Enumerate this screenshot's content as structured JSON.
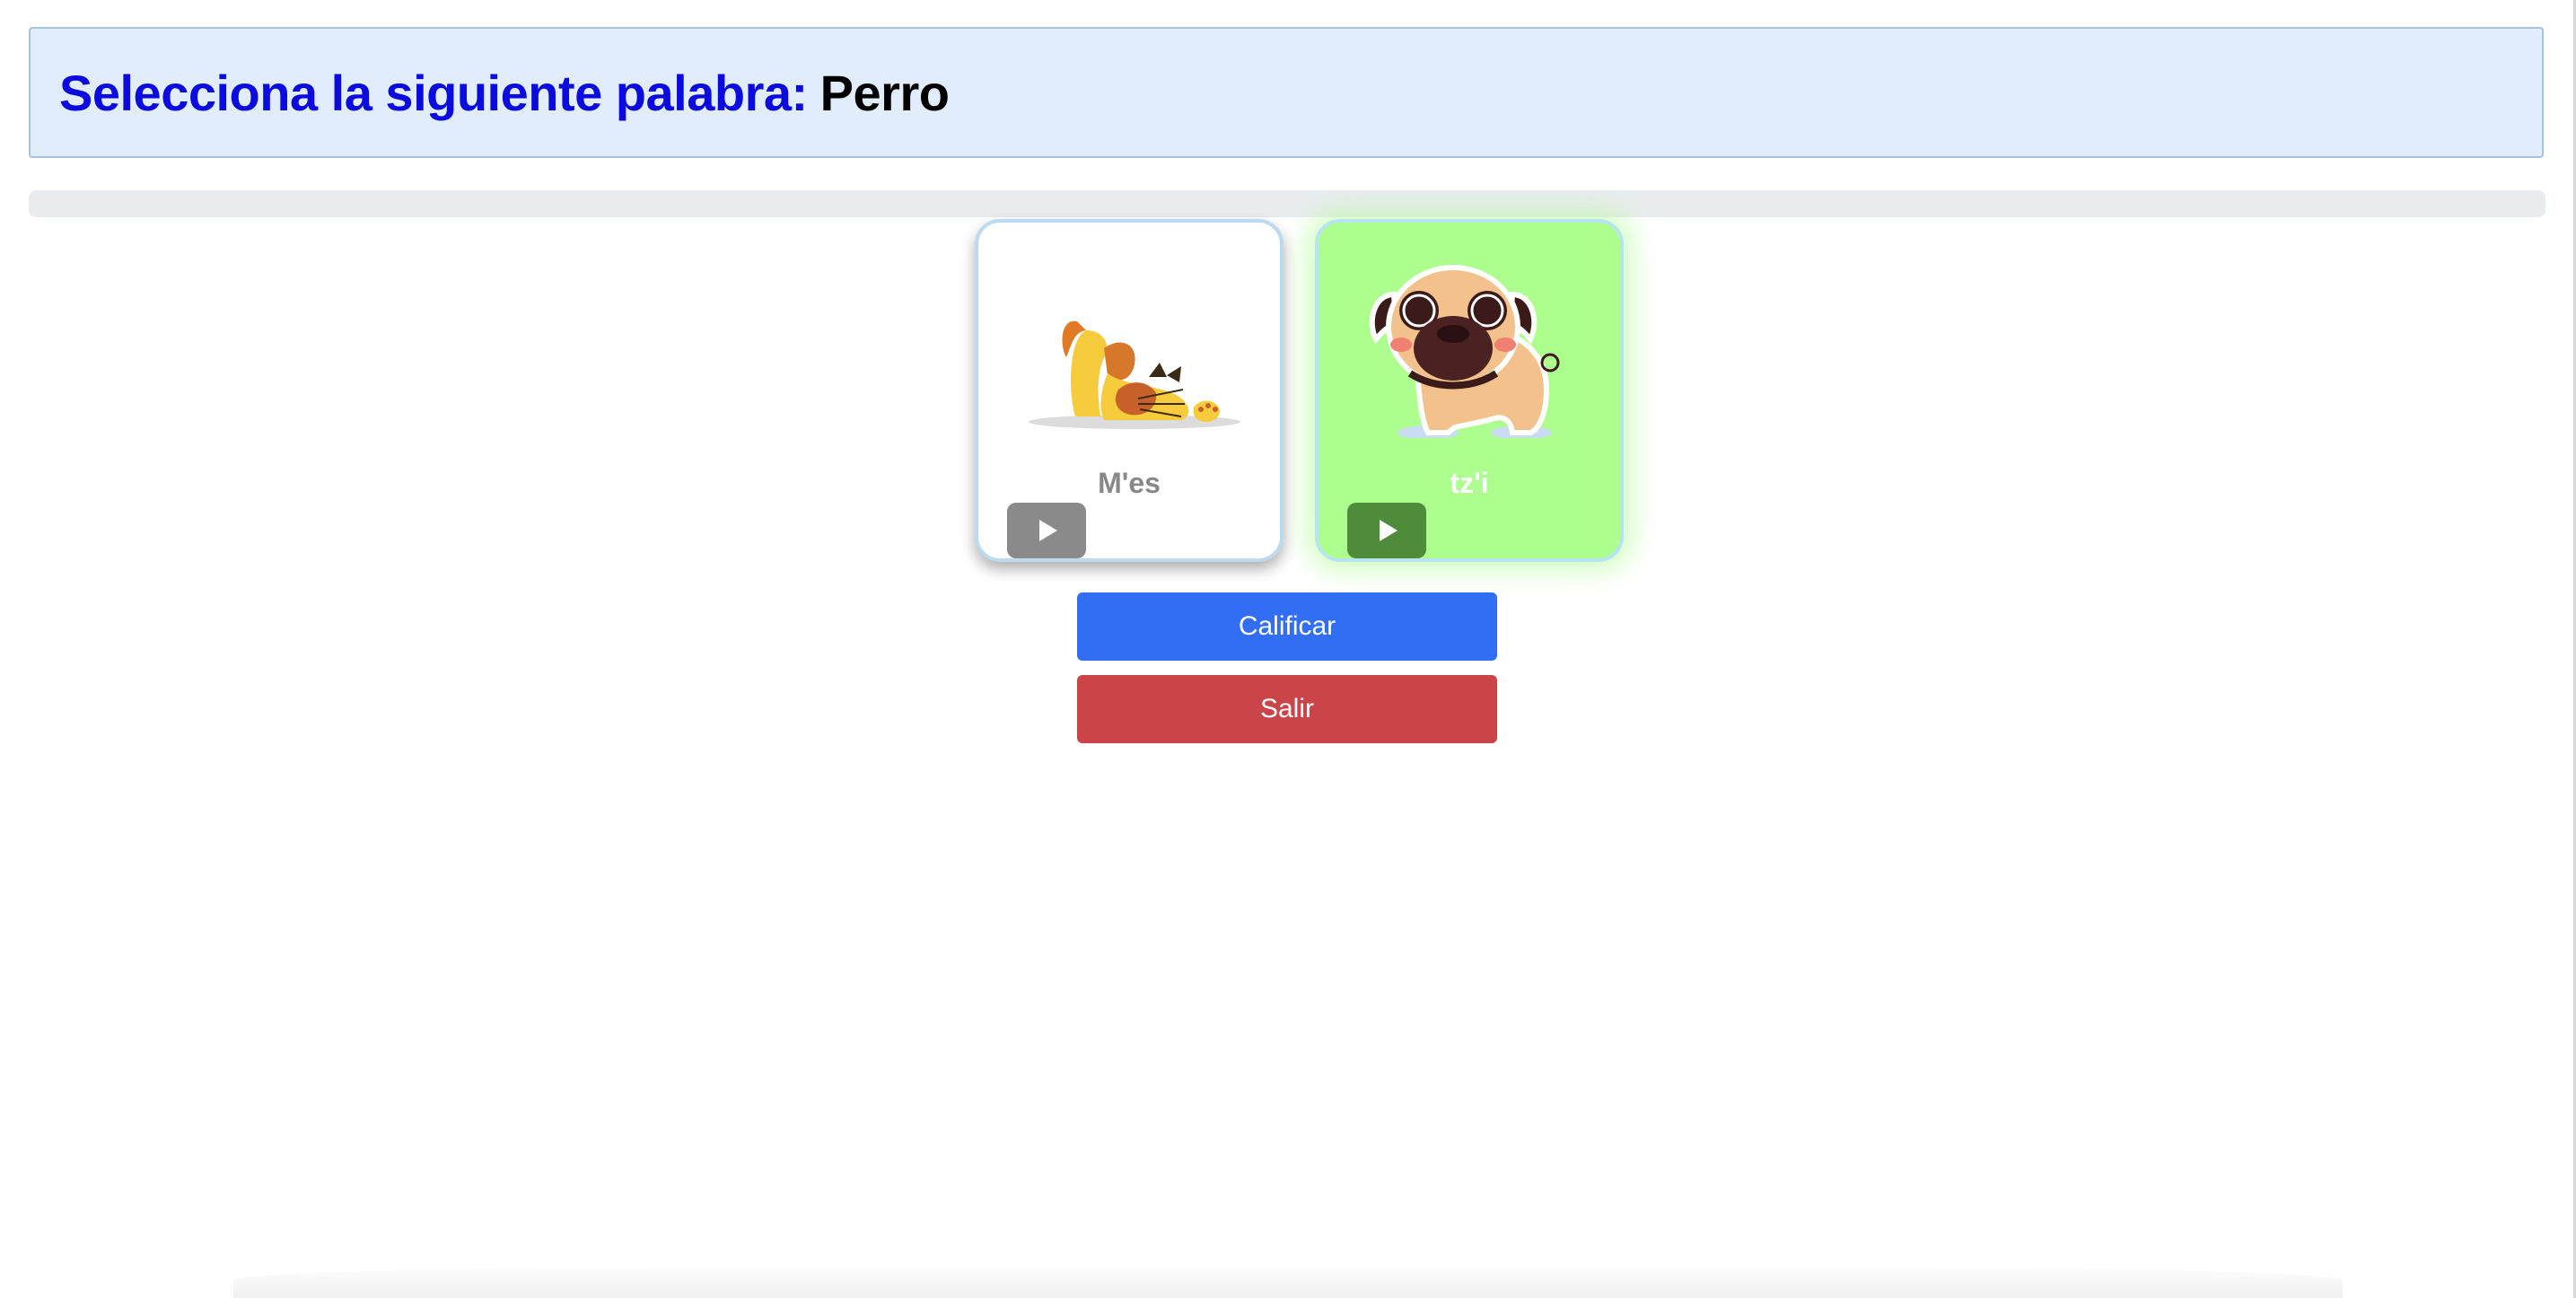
{
  "header": {
    "prompt": "Selecciona la siguiente palabra:",
    "target_word": "Perro"
  },
  "progress": {
    "value_percent": 0
  },
  "cards": [
    {
      "label": "M'es",
      "image": "cat-illustration",
      "selected": false
    },
    {
      "label": "tz'i",
      "image": "dog-illustration",
      "selected": true
    }
  ],
  "actions": {
    "grade_label": "Calificar",
    "exit_label": "Salir"
  },
  "colors": {
    "prompt": "#0b0bdf",
    "header_bg": "#e2edfb",
    "selected_card": "#adfe8f",
    "grade_button": "#316ef3",
    "exit_button": "#cb444a"
  },
  "icons": [
    "play-icon",
    "play-icon"
  ]
}
